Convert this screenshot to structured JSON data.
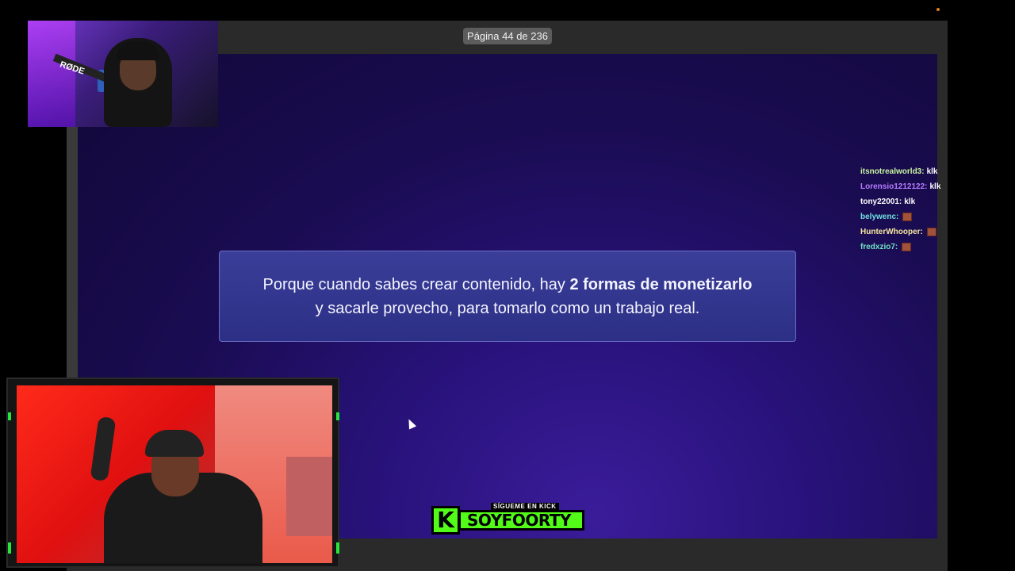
{
  "viewer": {
    "page_indicator": "Página 44 de 236"
  },
  "slide": {
    "text_before": "Porque cuando sabes crear contenido, hay ",
    "text_bold": "2 formas de monetizarlo",
    "text_after": "y sacarle provecho, para tomarlo como un trabajo real."
  },
  "webcam_top": {
    "mic_brand": "RØDE"
  },
  "kick_badge": {
    "subtitle": "SÍGUEME EN KICK",
    "logo_letter": "K",
    "channel": "SOYFOORTY",
    "color": "#53fc18"
  },
  "chat": [
    {
      "user": "itsnotrealworld3:",
      "message": "klk",
      "user_color": "#c8f5a0",
      "emote": false
    },
    {
      "user": "Lorensio1212122:",
      "message": "klk",
      "user_color": "#b77cff",
      "emote": false
    },
    {
      "user": "tony22001:",
      "message": "klk",
      "user_color": "#ffffff",
      "emote": false
    },
    {
      "user": "belywenc:",
      "message": "",
      "user_color": "#6fe0e0",
      "emote": true
    },
    {
      "user": "HunterWhooper:",
      "message": "",
      "user_color": "#f5e6a0",
      "emote": true
    },
    {
      "user": "fredxzio7:",
      "message": "",
      "user_color": "#6fe0c0",
      "emote": true
    }
  ]
}
